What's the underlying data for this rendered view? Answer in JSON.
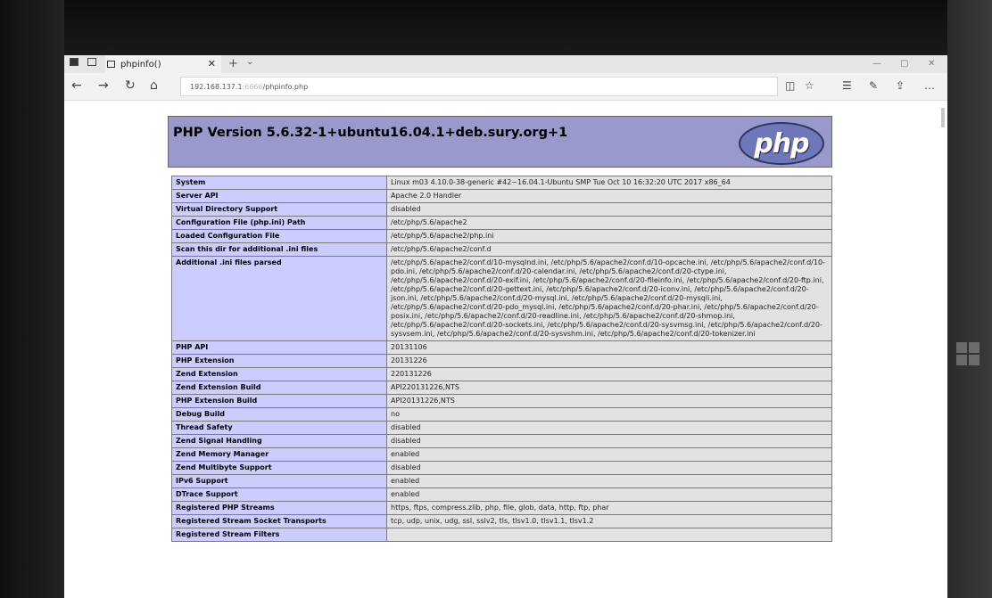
{
  "browser": {
    "tab_title": "phpinfo()",
    "url_host": "192.168.137.1",
    "url_port": ":6666",
    "url_path": "/phpinfo.php"
  },
  "page": {
    "title": "PHP Version 5.6.32-1+ubuntu16.04.1+deb.sury.org+1",
    "logo_text": "php"
  },
  "rows": [
    {
      "key": "System",
      "value": "Linux m03 4.10.0-38-generic #42~16.04.1-Ubuntu SMP Tue Oct 10 16:32:20 UTC 2017 x86_64"
    },
    {
      "key": "Server API",
      "value": "Apache 2.0 Handler"
    },
    {
      "key": "Virtual Directory Support",
      "value": "disabled"
    },
    {
      "key": "Configuration File (php.ini) Path",
      "value": "/etc/php/5.6/apache2"
    },
    {
      "key": "Loaded Configuration File",
      "value": "/etc/php/5.6/apache2/php.ini"
    },
    {
      "key": "Scan this dir for additional .ini files",
      "value": "/etc/php/5.6/apache2/conf.d"
    },
    {
      "key": "Additional .ini files parsed",
      "value": "/etc/php/5.6/apache2/conf.d/10-mysqlnd.ini, /etc/php/5.6/apache2/conf.d/10-opcache.ini, /etc/php/5.6/apache2/conf.d/10-pdo.ini, /etc/php/5.6/apache2/conf.d/20-calendar.ini, /etc/php/5.6/apache2/conf.d/20-ctype.ini, /etc/php/5.6/apache2/conf.d/20-exif.ini, /etc/php/5.6/apache2/conf.d/20-fileinfo.ini, /etc/php/5.6/apache2/conf.d/20-ftp.ini, /etc/php/5.6/apache2/conf.d/20-gettext.ini, /etc/php/5.6/apache2/conf.d/20-iconv.ini, /etc/php/5.6/apache2/conf.d/20-json.ini, /etc/php/5.6/apache2/conf.d/20-mysql.ini, /etc/php/5.6/apache2/conf.d/20-mysqli.ini, /etc/php/5.6/apache2/conf.d/20-pdo_mysql.ini, /etc/php/5.6/apache2/conf.d/20-phar.ini, /etc/php/5.6/apache2/conf.d/20-posix.ini, /etc/php/5.6/apache2/conf.d/20-readline.ini, /etc/php/5.6/apache2/conf.d/20-shmop.ini, /etc/php/5.6/apache2/conf.d/20-sockets.ini, /etc/php/5.6/apache2/conf.d/20-sysvmsg.ini, /etc/php/5.6/apache2/conf.d/20-sysvsem.ini, /etc/php/5.6/apache2/conf.d/20-sysvshm.ini, /etc/php/5.6/apache2/conf.d/20-tokenizer.ini"
    },
    {
      "key": "PHP API",
      "value": "20131106"
    },
    {
      "key": "PHP Extension",
      "value": "20131226"
    },
    {
      "key": "Zend Extension",
      "value": "220131226"
    },
    {
      "key": "Zend Extension Build",
      "value": "API220131226,NTS"
    },
    {
      "key": "PHP Extension Build",
      "value": "API20131226,NTS"
    },
    {
      "key": "Debug Build",
      "value": "no"
    },
    {
      "key": "Thread Safety",
      "value": "disabled"
    },
    {
      "key": "Zend Signal Handling",
      "value": "disabled"
    },
    {
      "key": "Zend Memory Manager",
      "value": "enabled"
    },
    {
      "key": "Zend Multibyte Support",
      "value": "disabled"
    },
    {
      "key": "IPv6 Support",
      "value": "enabled"
    },
    {
      "key": "DTrace Support",
      "value": "enabled"
    },
    {
      "key": "Registered PHP Streams",
      "value": "https, ftps, compress.zlib, php, file, glob, data, http, ftp, phar"
    },
    {
      "key": "Registered Stream Socket Transports",
      "value": "tcp, udp, unix, udg, ssl, sslv2, tls, tlsv1.0, tlsv1.1, tlsv1.2"
    },
    {
      "key": "Registered Stream Filters",
      "value": ""
    }
  ],
  "colors": {
    "header_bg": "#9999cc",
    "key_cell_bg": "#ccccff",
    "value_cell_bg": "#e2e2e2"
  }
}
